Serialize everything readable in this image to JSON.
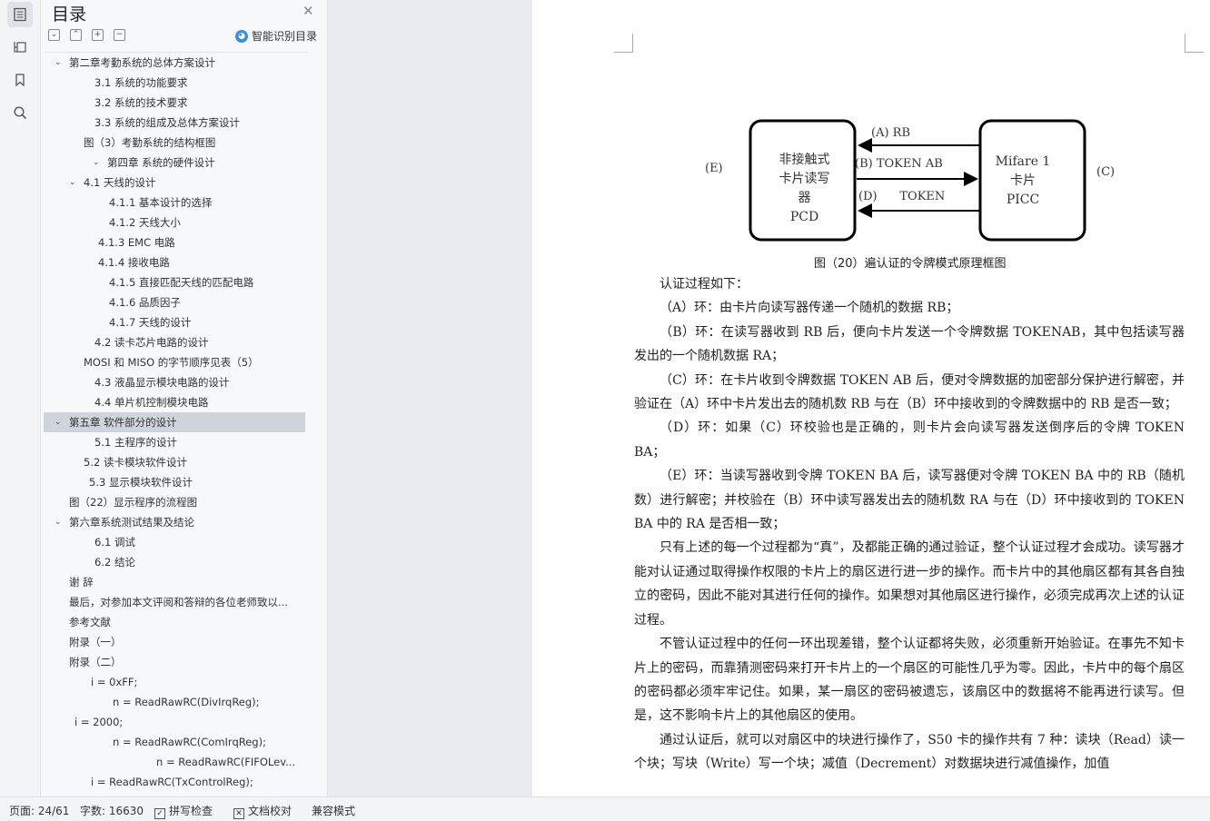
{
  "toc": {
    "title": "目录",
    "smart_label": "智能识别目录",
    "items": [
      {
        "text": "第二章考勤系统的总体方案设计",
        "arrow": "open",
        "indent": 28,
        "sel": false
      },
      {
        "text": "3.1 系统的功能要求",
        "arrow": "",
        "indent": 56,
        "sel": false
      },
      {
        "text": "3.2 系统的技术要求",
        "arrow": "",
        "indent": 56,
        "sel": false
      },
      {
        "text": "3.3  系统的组成及总体方案设计",
        "arrow": "",
        "indent": 56,
        "sel": false
      },
      {
        "text": "图（3）考勤系统的结构框图",
        "arrow": "",
        "indent": 44,
        "sel": false
      },
      {
        "text": "第四章  系统的硬件设计",
        "arrow": "open",
        "indent": 70,
        "sel": false
      },
      {
        "text": "4.1 天线的设计",
        "arrow": "open",
        "indent": 44,
        "sel": false
      },
      {
        "text": "4.1.1 基本设计的选择",
        "arrow": "",
        "indent": 72,
        "sel": false
      },
      {
        "text": "4.1.2  天线大小",
        "arrow": "",
        "indent": 72,
        "sel": false
      },
      {
        "text": "4.1.3 EMC  电路",
        "arrow": "",
        "indent": 60,
        "sel": false
      },
      {
        "text": "4.1.4  接收电路",
        "arrow": "",
        "indent": 60,
        "sel": false
      },
      {
        "text": "4.1.5 直接匹配天线的匹配电路",
        "arrow": "",
        "indent": 72,
        "sel": false
      },
      {
        "text": "4.1.6 品质因子",
        "arrow": "",
        "indent": 72,
        "sel": false
      },
      {
        "text": "4.1.7 天线的设计",
        "arrow": "",
        "indent": 72,
        "sel": false
      },
      {
        "text": "4.2 读卡芯片电路的设计",
        "arrow": "",
        "indent": 56,
        "sel": false
      },
      {
        "text": "MOSI 和 MISO 的字节顺序见表（5）",
        "arrow": "",
        "indent": 44,
        "sel": false
      },
      {
        "text": "4.3 液晶显示模块电路的设计",
        "arrow": "",
        "indent": 56,
        "sel": false
      },
      {
        "text": "4.4 单片机控制模块电路",
        "arrow": "",
        "indent": 56,
        "sel": false
      },
      {
        "text": "第五章    软件部分的设计",
        "arrow": "open",
        "indent": 28,
        "sel": true
      },
      {
        "text": "5.1 主程序的设计",
        "arrow": "",
        "indent": 56,
        "sel": false
      },
      {
        "text": "5.2 读卡模块软件设计",
        "arrow": "",
        "indent": 44,
        "sel": false
      },
      {
        "text": "5.3 显示模块软件设计",
        "arrow": "",
        "indent": 50,
        "sel": false
      },
      {
        "text": "图（22）显示程序的流程图",
        "arrow": "",
        "indent": 28,
        "sel": false
      },
      {
        "text": "第六章系统测试结果及结论",
        "arrow": "open",
        "indent": 28,
        "sel": false
      },
      {
        "text": "6.1 调试",
        "arrow": "",
        "indent": 56,
        "sel": false
      },
      {
        "text": "6.2 结论",
        "arrow": "",
        "indent": 56,
        "sel": false
      },
      {
        "text": "谢  辞",
        "arrow": "",
        "indent": 28,
        "sel": false
      },
      {
        "text": "最后，对参加本文评阅和答辩的各位老师致以...",
        "arrow": "",
        "indent": 28,
        "sel": false
      },
      {
        "text": "参考文献",
        "arrow": "",
        "indent": 28,
        "sel": false
      },
      {
        "text": "附录（一）",
        "arrow": "",
        "indent": 28,
        "sel": false
      },
      {
        "text": "附录（二）",
        "arrow": "",
        "indent": 28,
        "sel": false
      },
      {
        "text": "i = 0xFF;",
        "arrow": "",
        "indent": 52,
        "sel": false
      },
      {
        "text": "n = ReadRawRC(DivIrqReg);",
        "arrow": "",
        "indent": 76,
        "sel": false
      },
      {
        "text": "i = 2000;",
        "arrow": "",
        "indent": 34,
        "sel": false
      },
      {
        "text": "n = ReadRawRC(ComIrqReg);",
        "arrow": "",
        "indent": 76,
        "sel": false
      },
      {
        "text": "n = ReadRawRC(FIFOLev...",
        "arrow": "",
        "indent": 124,
        "sel": false
      },
      {
        "text": "i = ReadRawRC(TxControlReg);",
        "arrow": "",
        "indent": 52,
        "sel": false
      }
    ]
  },
  "diagram": {
    "left_label": "(E)",
    "right_label": "(C)",
    "pcd_lines": [
      "非接触式",
      "卡片读写",
      "器",
      "PCD"
    ],
    "card_lines": [
      "Mifare 1",
      "卡片",
      "PICC"
    ],
    "arrow_a": "(A) RB",
    "arrow_b": "(B) TOKEN AB",
    "arrow_d": "(D)      TOKEN",
    "caption": "图（20）遍认证的令牌模式原理框图"
  },
  "paragraphs": [
    "认证过程如下：",
    "（A）环：由卡片向读写器传递一个随机的数据 RB；",
    "（B）环：在读写器收到 RB 后，便向卡片发送一个令牌数据 TOKENAB，其中包括读写器发出的一个随机数据 RA；",
    "（C）环：在卡片收到令牌数据 TOKEN AB 后，便对令牌数据的加密部分保护进行解密，并验证在（A）环中卡片发出去的随机数 RB 与在（B）环中接收到的令牌数据中的 RB 是否一致；",
    "（D）环：如果（C）环校验也是正确的，则卡片会向读写器发送倒序后的令牌 TOKEN BA；",
    "（E）环：当读写器收到令牌 TOKEN BA 后，读写器便对令牌 TOKEN BA 中的 RB（随机数）进行解密；并校验在（B）环中读写器发出去的随机数 RA 与在（D）环中接收到的 TOKEN BA 中的 RA 是否相一致；",
    "只有上述的每一个过程都为“真”，及都能正确的通过验证，整个认证过程才会成功。读写器才能对认证通过取得操作权限的卡片上的扇区进行进一步的操作。而卡片中的其他扇区都有其各自独立的密码，因此不能对其进行任何的操作。如果想对其他扇区进行操作，必须完成再次上述的认证过程。",
    "不管认证过程中的任何一环出现差错，整个认证都将失败，必须重新开始验证。在事先不知卡片上的密码，而靠猜测密码来打开卡片上的一个扇区的可能性几乎为零。因此，卡片中的每个扇区的密码都必须牢牢记住。如果，某一扇区的密码被遗忘，该扇区中的数据将不能再进行读写。但是，这不影响卡片上的其他扇区的使用。",
    "通过认证后，就可以对扇区中的块进行操作了，S50 卡的操作共有 7 种：读块（Read）读一个块；写块（Write）写一个块；减值（Decrement）对数据块进行减值操作，加值"
  ],
  "status": {
    "page": "页面: 24/61",
    "words": "字数: 16630",
    "spell": "拼写检查",
    "proof": "文档校对",
    "compat": "兼容模式"
  }
}
